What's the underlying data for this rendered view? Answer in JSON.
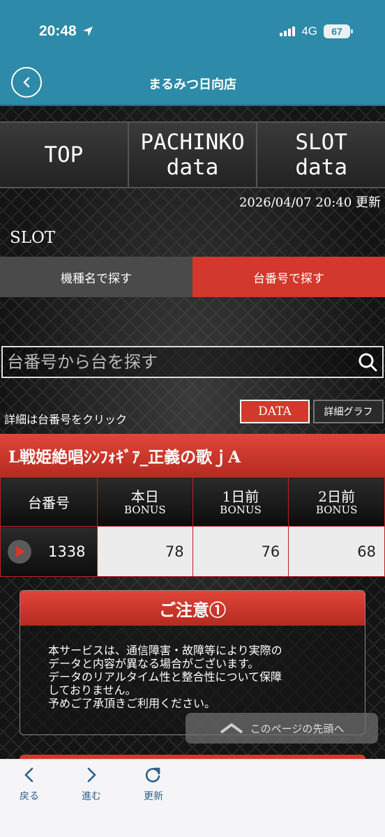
{
  "status": {
    "time": "20:48",
    "network": "4G",
    "battery": "67"
  },
  "header": {
    "title": "まるみつ日向店"
  },
  "top_nav": {
    "top": "TOP",
    "pachinko": "PACHINKO\ndata",
    "slot": "SLOT\ndata"
  },
  "updated": "2026/04/07 20:40 更新",
  "section": "SLOT",
  "tabs": {
    "by_model": "機種名で探す",
    "by_number": "台番号で探す"
  },
  "search": {
    "placeholder": "台番号から台を探す"
  },
  "hint": "詳細は台番号をクリック",
  "buttons": {
    "data": "DATA",
    "graph": "詳細グラフ"
  },
  "machine": {
    "name": "L戦姫絶唱ｼﾝﾌｫｷﾞｱ_正義の歌ｊA"
  },
  "table": {
    "col_number": "台番号",
    "col_today": "本日",
    "col_1day": "1日前",
    "col_2day": "2日前",
    "col_sub": "BONUS",
    "rows": [
      {
        "number": "1338",
        "today": "78",
        "day1": "76",
        "day2": "68"
      }
    ]
  },
  "notice": {
    "title": "ご注意①",
    "body": "本サービスは、通信障害・故障等により実際の\nデータと内容が異なる場合がございます。\nデータのリアルタイム性と整合性について保障\nしておりません。\n予めご了承頂きご利用ください。"
  },
  "scroll_top": "このページの先頭へ",
  "bottom_bar": {
    "back": "戻る",
    "forward": "進む",
    "reload": "更新"
  }
}
